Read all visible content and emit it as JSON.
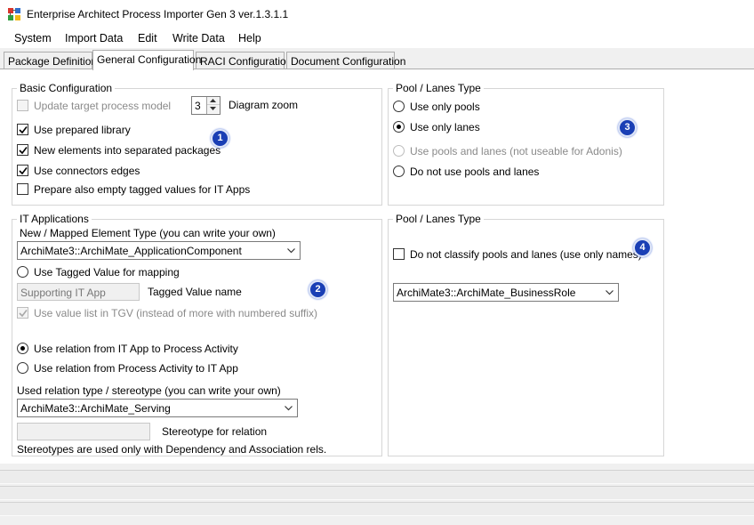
{
  "window": {
    "title": "Enterprise Architect Process Importer Gen 3 ver.1.3.1.1"
  },
  "menu": {
    "items": [
      "System",
      "Import Data",
      "Edit",
      "Write Data",
      "Help"
    ]
  },
  "tabs": [
    "Package Definition",
    "General Configuration",
    "RACI Configuration",
    "Document Configuration"
  ],
  "active_tab": "General Configuration",
  "basic_config": {
    "title": "Basic Configuration",
    "update_target_label": "Update target process model",
    "diagram_zoom_value": "3",
    "diagram_zoom_label": "Diagram zoom",
    "use_prepared_library_label": "Use prepared library",
    "new_elements_label": "New elements into separated packages",
    "use_connectors_label": "Use connectors edges",
    "prepare_empty_tv_label": "Prepare also empty tagged values for IT Apps",
    "badge": "1"
  },
  "pool_lanes_1": {
    "title": "Pool / Lanes Type",
    "option_pools": "Use only pools",
    "option_lanes": "Use only lanes",
    "option_pools_and_lanes": "Use pools and lanes (not useable for Adonis)",
    "option_none": "Do not use pools and lanes",
    "badge": "3"
  },
  "it_apps": {
    "title": "IT Applications",
    "element_type_label": "New / Mapped Element Type (you can write your own)",
    "element_type_value": "ArchiMate3::ArchiMate_ApplicationComponent",
    "use_tagged_value_label": "Use Tagged Value for mapping",
    "tagged_value_field": "Supporting IT App",
    "tagged_value_name_label": "Tagged Value name",
    "use_value_list_label": "Use value list in TGV (instead of more with numbered suffix)",
    "relation_app_to_activity": "Use relation from IT App to Process Activity",
    "relation_activity_to_app": "Use relation from Process Activity to IT App",
    "relation_type_label": "Used relation type / stereotype (you can write your own)",
    "relation_type_value": "ArchiMate3::ArchiMate_Serving",
    "stereotype_field": "",
    "stereotype_label": "Stereotype for relation",
    "note": "Stereotypes are used only with Dependency and Association rels.",
    "badge": "2"
  },
  "pool_lanes_2": {
    "title": "Pool / Lanes Type",
    "do_not_classify_label": "Do not classify pools and lanes (use only names)",
    "role_value": "ArchiMate3::ArchiMate_BusinessRole",
    "badge": "4"
  },
  "colors": {
    "badge": "#1a3fb5",
    "tab_active": "#ffffff",
    "window_bg": "#f0f0f0"
  }
}
